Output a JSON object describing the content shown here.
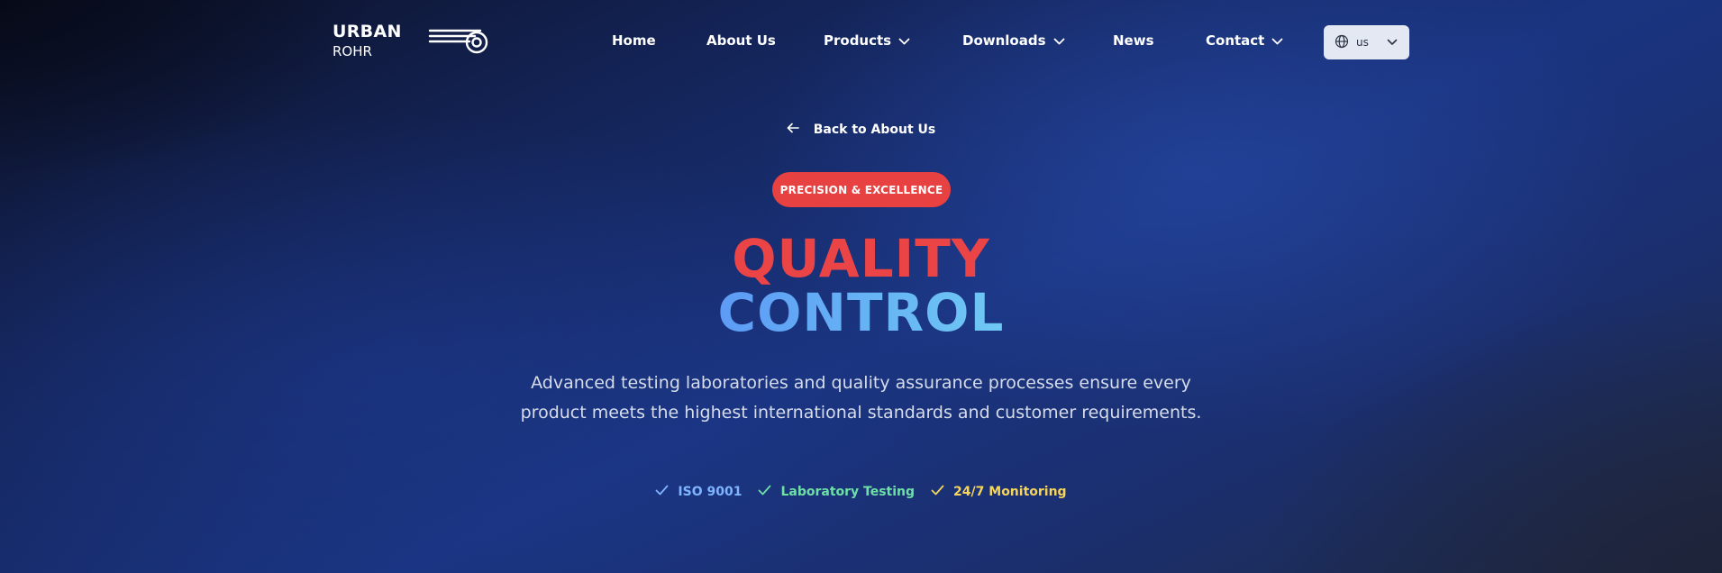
{
  "brand": {
    "line1": "URBAN",
    "line2": "ROHR"
  },
  "nav": {
    "items": [
      {
        "label": "Home",
        "dropdown": false
      },
      {
        "label": "About Us",
        "dropdown": false
      },
      {
        "label": "Products",
        "dropdown": true
      },
      {
        "label": "Downloads",
        "dropdown": true
      },
      {
        "label": "News",
        "dropdown": false
      },
      {
        "label": "Contact",
        "dropdown": true
      }
    ],
    "language": {
      "value": "us",
      "icon": "globe-icon"
    }
  },
  "hero": {
    "back_link": "Back to About Us",
    "badge": "PRECISION & EXCELLENCE",
    "title_line1": "QUALITY",
    "title_line2": "CONTROL",
    "description": "Advanced testing laboratories and quality assurance processes ensure every product meets the highest international standards and customer requirements.",
    "features": [
      {
        "label": "ISO 9001",
        "color": "#7fb4ff"
      },
      {
        "label": "Laboratory Testing",
        "color": "#6ee0a6"
      },
      {
        "label": "24/7 Monitoring",
        "color": "#f5d55a"
      }
    ]
  },
  "colors": {
    "badge": "#e84141",
    "title_red": "#ea4446",
    "title_blue_start": "#5d9bf5",
    "title_blue_end": "#6fc9f4",
    "lang_bg": "#e4e8f2"
  }
}
